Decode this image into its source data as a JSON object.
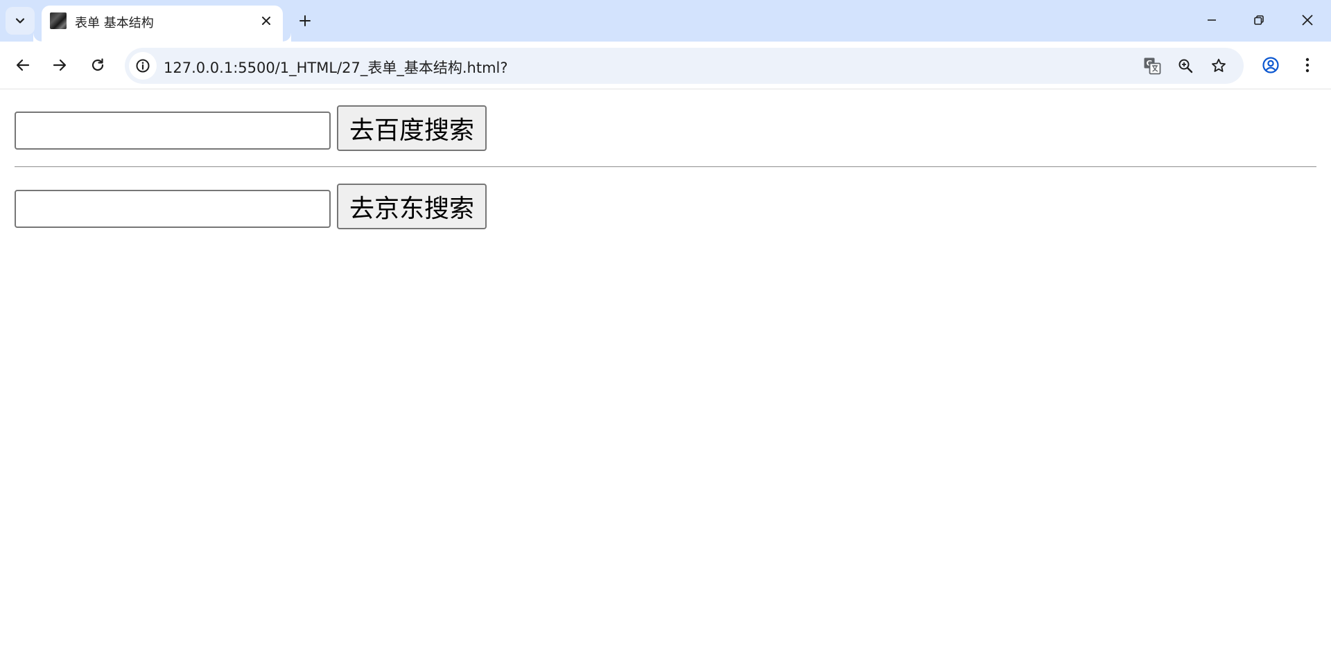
{
  "browser": {
    "tab": {
      "title": "表单 基本结构"
    },
    "address_bar": {
      "url": "127.0.0.1:5500/1_HTML/27_表单_基本结构.html?"
    },
    "icons": {
      "tab_search": "chevron-down-icon",
      "tab_close": "close-icon",
      "new_tab": "plus-icon",
      "minimize": "minimize-icon",
      "restore": "restore-icon",
      "close_window": "close-icon",
      "back": "arrow-left-icon",
      "forward": "arrow-right-icon",
      "reload": "reload-icon",
      "site_info": "info-icon",
      "translate": "translate-icon",
      "zoom": "zoom-in-icon",
      "bookmark": "star-icon",
      "profile": "account-icon",
      "menu": "more-vert-icon"
    },
    "colors": {
      "tab_strip": "#d3e3fd",
      "omnibox": "#edf2fa",
      "profile_accent": "#0b57d0"
    }
  },
  "page": {
    "forms": [
      {
        "input_value": "",
        "button_label": "去百度搜索"
      },
      {
        "input_value": "",
        "button_label": "去京东搜索"
      }
    ]
  }
}
